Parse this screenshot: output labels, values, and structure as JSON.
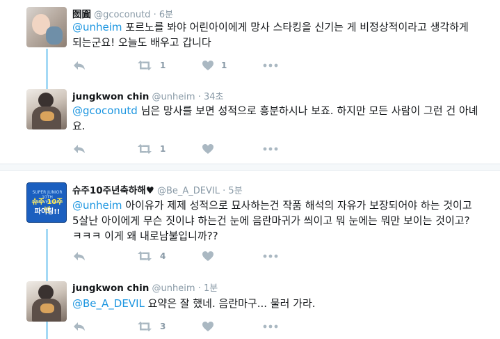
{
  "tweets": [
    {
      "name": "囫圇",
      "handle": "@gcoconutd",
      "dot": "·",
      "time": "6분",
      "mention": "@unheim",
      "text": " 포르노를 봐야 어린아이에게 망사 스타킹을 신기는 게 비정상적이라고 생각하게 되는군요! 오늘도 배우고 갑니다",
      "retweets": "1",
      "likes": "1"
    },
    {
      "name": "jungkwon chin",
      "handle": "@unheim",
      "dot": "·",
      "time": "34초",
      "mention": "@gcoconutd",
      "text": " 님은 망사를 보면 성적으로 흥분하시나 보죠. 하지만 모든 사람이 그런 건 아녜요.",
      "retweets": "1",
      "likes": ""
    },
    {
      "name": "슈주10주년축하해♥",
      "handle": "@Be_A_DEVIL",
      "dot": "·",
      "time": "5분",
      "mention": "@unheim",
      "text": " 아이유가 제제 성적으로 묘사하는건 작품 해석의 자유가 보장되어야 하는 것이고 5살난 아이에게 무슨 짓이냐 하는건 눈에 음란마귀가 씌이고 뭐 눈에는 뭐만 보이는 것이고?ㅋㅋㅋ 이게 왜 내로남불입니까??",
      "retweets": "4",
      "likes": ""
    },
    {
      "name": "jungkwon chin",
      "handle": "@unheim",
      "dot": "·",
      "time": "1분",
      "mention": "@Be_A_DEVIL",
      "text": " 요약은 잘 했네. 음란마구... 물러 가라.",
      "retweets": "3",
      "likes": ""
    }
  ],
  "avatars": {
    "suju_line1": "SUPER JUNIOR 10TH ANNIVERSARY",
    "suju_line2": "슈주 10주년",
    "suju_line3": "파이팅!!"
  },
  "icons": [
    "reply-icon",
    "retweet-icon",
    "like-icon",
    "more-icon"
  ],
  "colors": {
    "mention": "#1b95e0",
    "muted": "#8899a6",
    "thread": "#a4d9f5"
  }
}
